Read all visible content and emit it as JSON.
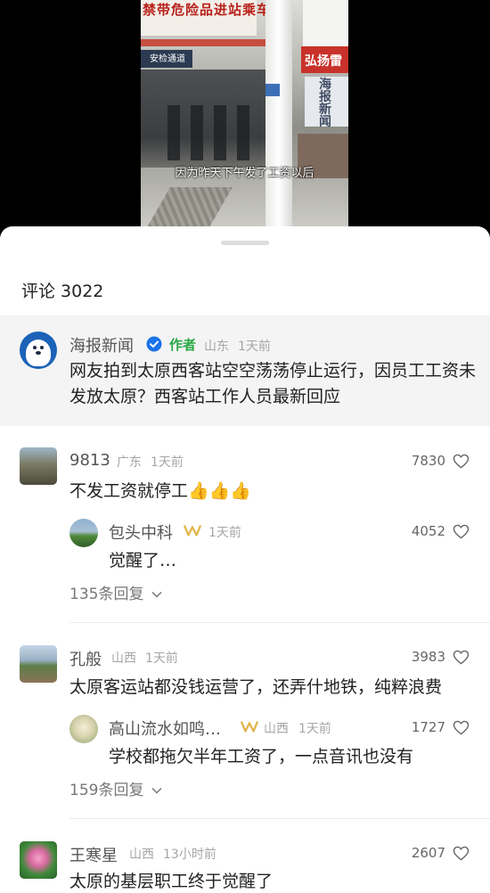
{
  "video": {
    "subtitle": "因为昨天下午发了工资以后",
    "banner_text": "禁带危险品进站乘车",
    "gate_text": "安检通道",
    "sign_text": "弘扬雷",
    "poster_text": "海报新闻"
  },
  "comments_header": {
    "label": "评论 3022"
  },
  "author_post": {
    "name": "海报新闻",
    "badge": "作者",
    "location": "山东",
    "time": "1天前",
    "text": "网友拍到太原西客站空空荡荡停止运行，因员工工资未发放太原？西客站工作人员最新回应"
  },
  "comments": [
    {
      "user": "9813",
      "location": "广东",
      "time": "1天前",
      "likes": "7830",
      "text": "不发工资就停工👍👍👍",
      "reply": {
        "user": "包头中科",
        "time": "1天前",
        "likes": "4052",
        "text": "觉醒了…"
      },
      "more": "135条回复"
    },
    {
      "user": "孔般",
      "location": "山西",
      "time": "1天前",
      "likes": "3983",
      "text": "太原客运站都没钱运营了，还弄什地铁，纯粹浪费",
      "reply": {
        "user": "高山流水如鸣…",
        "location": "山西",
        "time": "1天前",
        "likes": "1727",
        "text": "学校都拖欠半年工资了，一点音讯也没有"
      },
      "more": "159条回复"
    },
    {
      "user": "王寒星",
      "location": "山西",
      "time": "13小时前",
      "likes": "2607",
      "text": "太原的基层职工终于觉醒了"
    }
  ],
  "icons": {
    "like": "heart-icon",
    "verified": "verified-icon",
    "vip": "vip-badge-icon",
    "expand": "chevron-down-icon"
  },
  "colors": {
    "author_tag": "#28a745",
    "verified_blue": "#1a73e8",
    "vip_gold": "#e0b64a",
    "author_card_bg": "#f4f4f4"
  }
}
